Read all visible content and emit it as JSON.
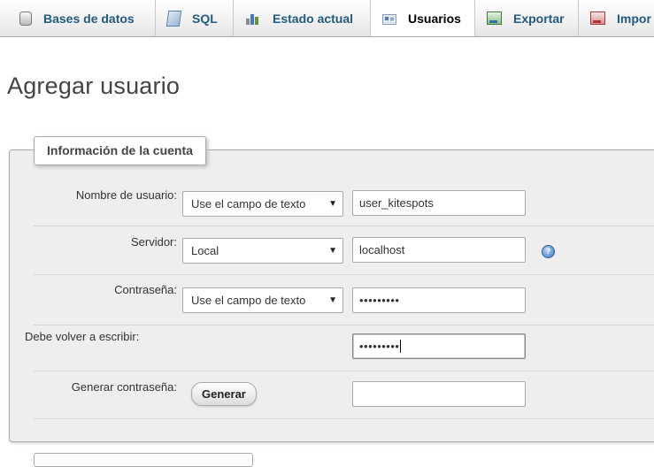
{
  "tabs": [
    {
      "label": "Bases de datos",
      "icon": "database-icon",
      "active": false
    },
    {
      "label": "SQL",
      "icon": "sql-icon",
      "active": false
    },
    {
      "label": "Estado actual",
      "icon": "status-chart-icon",
      "active": false
    },
    {
      "label": "Usuarios",
      "icon": "users-icon",
      "active": true
    },
    {
      "label": "Exportar",
      "icon": "export-icon",
      "active": false
    },
    {
      "label": "Impor",
      "icon": "import-icon",
      "active": false
    }
  ],
  "page": {
    "title": "Agregar usuario"
  },
  "account": {
    "legend": "Información de la cuenta",
    "username": {
      "label": "Nombre de usuario:",
      "select_value": "Use el campo de texto",
      "value": "user_kitespots"
    },
    "server": {
      "label": "Servidor:",
      "select_value": "Local",
      "value": "localhost",
      "help_icon": "help-icon"
    },
    "password": {
      "label": "Contraseña:",
      "select_value": "Use el campo de texto",
      "value": "•••••••••"
    },
    "retype": {
      "label": "Debe volver a escribir:",
      "value": "•••••••••"
    },
    "generate": {
      "label": "Generar contraseña:",
      "button": "Generar",
      "value": ""
    }
  },
  "colors": {
    "tab_link": "#235a81",
    "fieldset_bg": "#eeeeee",
    "border": "#aaaaaa"
  }
}
